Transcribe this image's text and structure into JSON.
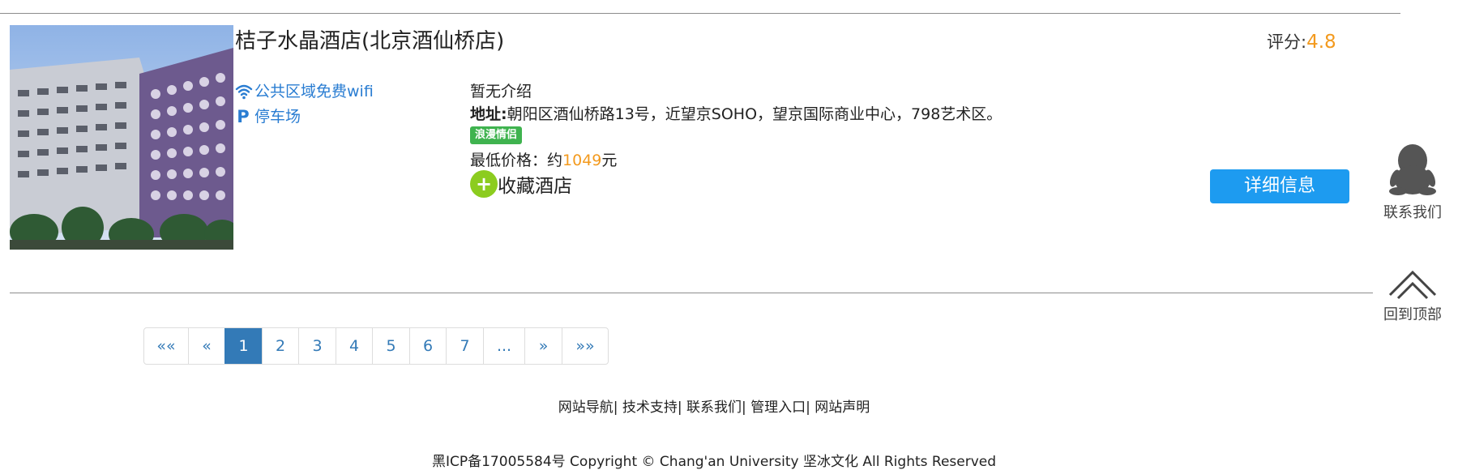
{
  "hotel": {
    "name": "桔子水晶酒店(北京酒仙桥店)",
    "photo_alt": "桔子水晶酒店",
    "amenities": [
      {
        "icon": "wifi-icon",
        "label": "公共区域免费wifi"
      },
      {
        "icon": "parking-icon",
        "label": "停车场",
        "glyph": "P"
      }
    ],
    "intro": "暂无介绍",
    "address_label": "地址:",
    "address": "朝阳区酒仙桥路13号，近望京SOHO，望京国际商业中心，798艺术区。",
    "tag": "浪漫情侣",
    "price_label": "最低价格：约",
    "price_value": "1049",
    "price_unit": "元",
    "favorite_label": "收藏酒店",
    "favorite_glyph": "+",
    "rating_label": "评分:",
    "rating_value": "4.8",
    "detail_button": "详细信息"
  },
  "floating": {
    "contact_label": "联系我们",
    "top_label": "回到顶部"
  },
  "pagination": {
    "items": [
      "««",
      "«",
      "1",
      "2",
      "3",
      "4",
      "5",
      "6",
      "7",
      "...",
      "»",
      "»»"
    ],
    "active": "1"
  },
  "footer": {
    "links": [
      "网站导航",
      "技术支持",
      "联系我们",
      "管理入口",
      "网站声明"
    ],
    "separator": "|",
    "copyright": "黑ICP备17005584号 Copyright © Chang'an University 坚冰文化 All Rights Reserved"
  },
  "colors": {
    "accent_blue": "#1d9bf0",
    "link_blue": "#337ab7",
    "price_orange": "#f39a1e",
    "tag_green": "#3fb34f",
    "fav_green": "#8ccc1f"
  }
}
